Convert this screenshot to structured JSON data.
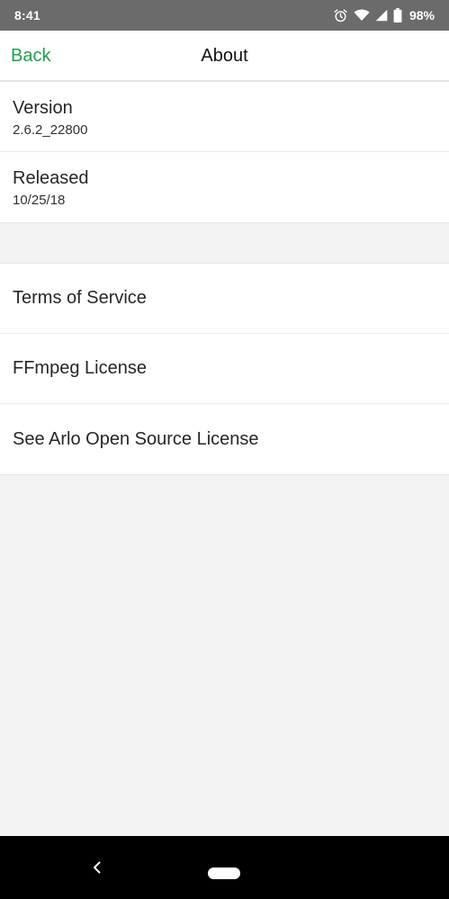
{
  "status_bar": {
    "time": "8:41",
    "battery": "98%",
    "icons": [
      "alarm-icon",
      "wifi-icon",
      "cellular-signal-icon",
      "battery-icon"
    ]
  },
  "nav": {
    "back_label": "Back",
    "title": "About",
    "accent_color": "#1aa34a"
  },
  "info": {
    "version_label": "Version",
    "version_value": "2.6.2_22800",
    "released_label": "Released",
    "released_value": "10/25/18"
  },
  "links": [
    {
      "label": "Terms of Service"
    },
    {
      "label": "FFmpeg License"
    },
    {
      "label": "See Arlo Open Source License"
    }
  ],
  "system_nav": {
    "icons": [
      "back-chevron-icon",
      "home-pill-icon"
    ]
  }
}
